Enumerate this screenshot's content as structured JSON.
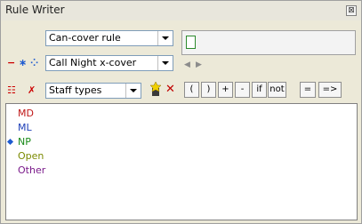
{
  "window": {
    "title": "Rule Writer",
    "close_glyph": "⊠"
  },
  "rule_type": {
    "selected": "Can-cover rule"
  },
  "rule": {
    "selected": "Call Night x-cover",
    "remove_glyph": "−",
    "new_glyph": "∗",
    "dots_glyph": "⁘"
  },
  "filter": {
    "selected": "Staff types",
    "list_glyph": "☷",
    "clear_glyph": "✗",
    "delete_glyph": "✕"
  },
  "operators": {
    "open_paren": "(",
    "close_paren": ")",
    "plus": "+",
    "minus": "-",
    "if": "if",
    "not": "not",
    "equals": "=",
    "implies": "=>"
  },
  "staff_types": [
    {
      "label": "MD",
      "color": "#c01818",
      "selected": false
    },
    {
      "label": "ML",
      "color": "#1f40b8",
      "selected": false
    },
    {
      "label": "NP",
      "color": "#1a8a1a",
      "selected": true
    },
    {
      "label": "Open",
      "color": "#7b8a00",
      "selected": false
    },
    {
      "label": "Other",
      "color": "#7a1a8a",
      "selected": false
    }
  ],
  "colors": {
    "remove": "#cc0000",
    "accent_blue": "#1e5bd0",
    "delete": "#c00000"
  }
}
